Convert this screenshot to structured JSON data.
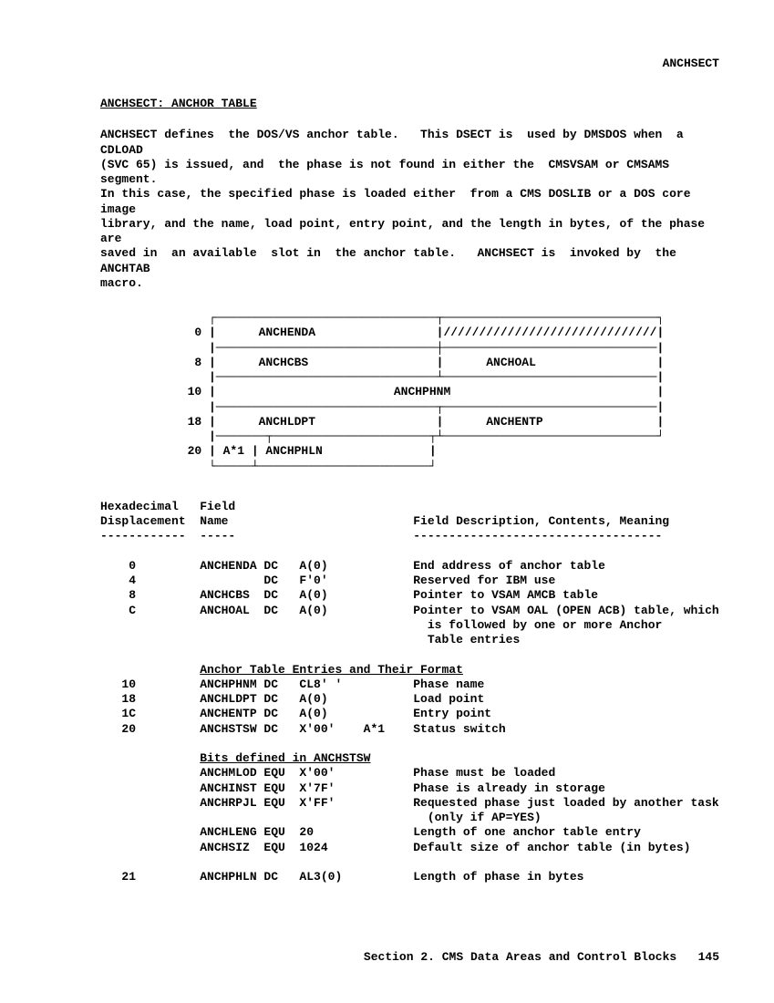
{
  "running_head": "ANCHSECT",
  "title": "ANCHSECT: ANCHOR TABLE",
  "paragraph": "ANCHSECT defines  the DOS/VS anchor table.   This DSECT is  used by DMSDOS when  a CDLOAD\n(SVC 65) is issued, and  the phase is not found in either the  CMSVSAM or CMSAMS segment.\nIn this case, the specified phase is loaded either  from a CMS DOSLIB or a DOS core image\nlibrary, and the name, load point, entry point, and the length in bytes, of the phase are\nsaved in  an available  slot in  the anchor table.   ANCHSECT is  invoked by  the ANCHTAB\nmacro.",
  "diagram": "     ┌───────────────────────────────┬──────────────────────────────┐\n   0 |      ANCHENDA                 |//////////////////////////////|\n     |───────────────────────────────┼──────────────────────────────|\n   8 |      ANCHCBS                  |      ANCHOAL                 |\n     |───────────────────────────────┴──────────────────────────────|\n  10 |                         ANCHPHNM                             |\n     |───────────────────────────────┬──────────────────────────────|\n  18 |      ANCHLDPT                 |      ANCHENTP                |\n     |───────┬──────────────────────┬┴──────────────────────────────┘\n  20 | A*1 | ANCHPHLN               |\n     └─────┴────────────────────────┘",
  "headers": {
    "col1a": "Hexadecimal",
    "col1b": "Displacement",
    "col2a": "Field",
    "col2b": "Name",
    "col3": "Field Description, Contents, Meaning",
    "ul1": "------------",
    "ul2": "-----",
    "ul3": "-----------------------------------"
  },
  "rows": [
    {
      "disp": "0",
      "name": "ANCHENDA",
      "op": "DC",
      "val": "A(0)",
      "note": "",
      "desc": "End address of anchor table"
    },
    {
      "disp": "4",
      "name": "",
      "op": "DC",
      "val": "F'0'",
      "note": "",
      "desc": "Reserved for IBM use"
    },
    {
      "disp": "8",
      "name": "ANCHCBS",
      "op": "DC",
      "val": "A(0)",
      "note": "",
      "desc": "Pointer to VSAM AMCB table"
    },
    {
      "disp": "C",
      "name": "ANCHOAL",
      "op": "DC",
      "val": "A(0)",
      "note": "",
      "desc": "Pointer to VSAM OAL (OPEN ACB) table, which"
    },
    {
      "disp": "",
      "name": "",
      "op": "",
      "val": "",
      "note": "",
      "desc": "  is followed by one or more Anchor"
    },
    {
      "disp": "",
      "name": "",
      "op": "",
      "val": "",
      "note": "",
      "desc": "  Table entries"
    }
  ],
  "subhead1": "Anchor Table Entries and Their Format",
  "rows2": [
    {
      "disp": "10",
      "name": "ANCHPHNM",
      "op": "DC",
      "val": "CL8' '",
      "note": "",
      "desc": "Phase name"
    },
    {
      "disp": "18",
      "name": "ANCHLDPT",
      "op": "DC",
      "val": "A(0)",
      "note": "",
      "desc": "Load point"
    },
    {
      "disp": "1C",
      "name": "ANCHENTP",
      "op": "DC",
      "val": "A(0)",
      "note": "",
      "desc": "Entry point"
    },
    {
      "disp": "20",
      "name": "ANCHSTSW",
      "op": "DC",
      "val": "X'00'",
      "note": "A*1",
      "desc": "Status switch"
    }
  ],
  "subhead2": "Bits defined in ANCHSTSW",
  "rows3": [
    {
      "disp": "",
      "name": "ANCHMLOD",
      "op": "EQU",
      "val": "X'00'",
      "note": "",
      "desc": "Phase must be loaded"
    },
    {
      "disp": "",
      "name": "ANCHINST",
      "op": "EQU",
      "val": "X'7F'",
      "note": "",
      "desc": "Phase is already in storage"
    },
    {
      "disp": "",
      "name": "ANCHRPJL",
      "op": "EQU",
      "val": "X'FF'",
      "note": "",
      "desc": "Requested phase just loaded by another task"
    },
    {
      "disp": "",
      "name": "",
      "op": "",
      "val": "",
      "note": "",
      "desc": "  (only if AP=YES)"
    },
    {
      "disp": "",
      "name": "ANCHLENG",
      "op": "EQU",
      "val": "20",
      "note": "",
      "desc": "Length of one anchor table entry"
    },
    {
      "disp": "",
      "name": "ANCHSIZ",
      "op": "EQU",
      "val": "1024",
      "note": "",
      "desc": "Default size of anchor table (in bytes)"
    }
  ],
  "rows4": [
    {
      "disp": "21",
      "name": "ANCHPHLN",
      "op": "DC",
      "val": "AL3(0)",
      "note": "",
      "desc": "Length of phase in bytes"
    }
  ],
  "footer": {
    "text": "Section 2. CMS Data Areas and Control Blocks",
    "page": "145"
  }
}
